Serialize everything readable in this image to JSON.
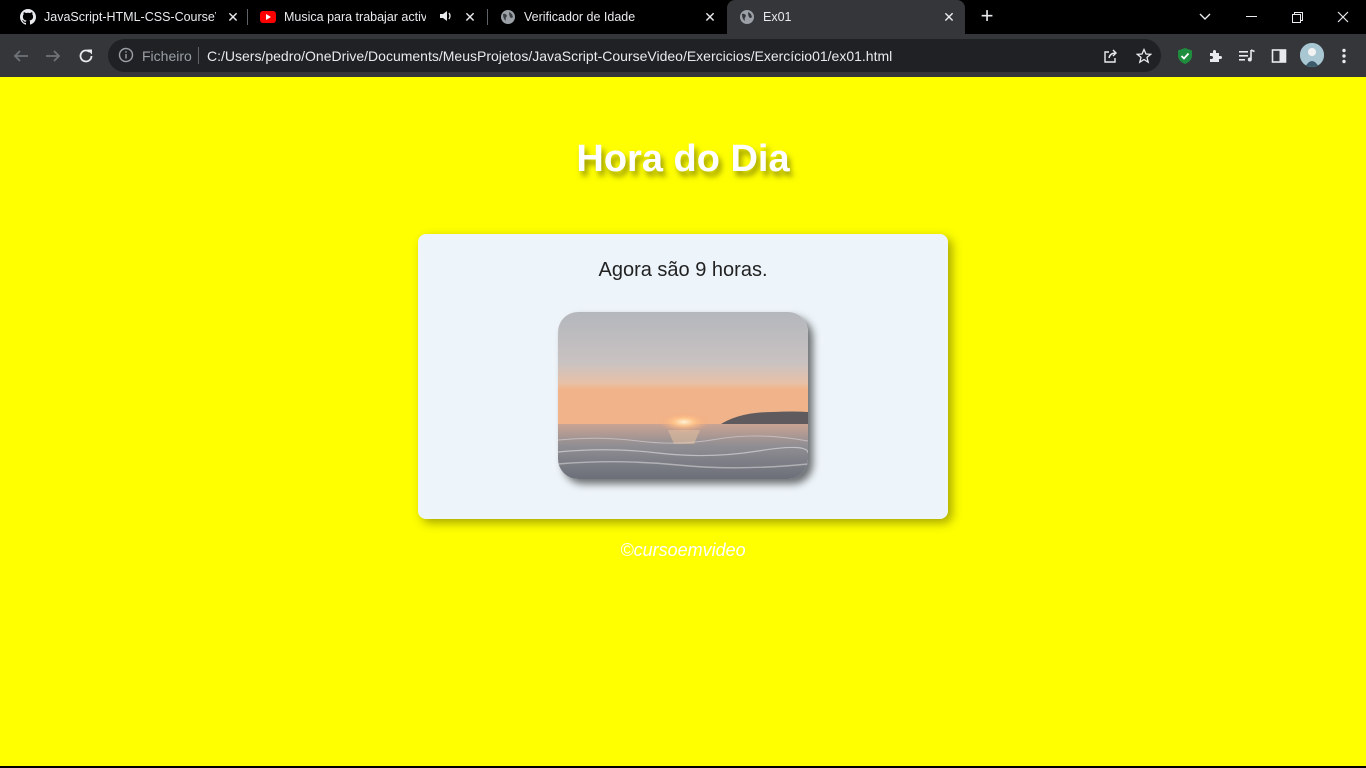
{
  "browser": {
    "tabs": [
      {
        "title": "JavaScript-HTML-CSS-CourseVid",
        "favicon": "github-icon",
        "active": false
      },
      {
        "title": "Musica para trabajar activo y",
        "favicon": "youtube-icon",
        "audio": true,
        "active": false
      },
      {
        "title": "Verificador de Idade",
        "favicon": "globe-icon",
        "active": false
      },
      {
        "title": "Ex01",
        "favicon": "globe-icon",
        "active": true
      }
    ],
    "address": {
      "scheme_label": "Ficheiro",
      "url": "C:/Users/pedro/OneDrive/Documents/MeusProjetos/JavaScript-CourseVideo/Exercicios/Exercício01/ex01.html"
    }
  },
  "page": {
    "background": "#ffff00",
    "title": "Hora do Dia",
    "message": "Agora são 9 horas.",
    "image": "sunrise-over-sea",
    "footer": "©cursoemvideo"
  }
}
